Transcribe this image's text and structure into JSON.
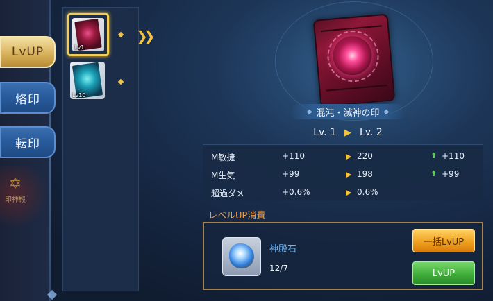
{
  "tabs": [
    {
      "label": "LvUP",
      "active": true
    },
    {
      "label": "烙印",
      "active": false
    },
    {
      "label": "転印",
      "active": false
    }
  ],
  "locked_menu": {
    "icon": "star-emblem-icon",
    "label": "印神殿"
  },
  "card_list": [
    {
      "level_text": "Lv1",
      "selected": true,
      "theme": "red"
    },
    {
      "level_text": "Lv10",
      "selected": false,
      "theme": "cyan"
    }
  ],
  "card": {
    "name": "混沌・滅神の印",
    "level_from": "Lv. 1",
    "level_to": "Lv. 2"
  },
  "stats": [
    {
      "name": "M敏捷",
      "current": "+110",
      "next": "220",
      "diff": "+110"
    },
    {
      "name": "M生気",
      "current": "+99",
      "next": "198",
      "diff": "+99"
    },
    {
      "name": "超過ダメ",
      "current": "+0.6%",
      "next": "0.6%",
      "diff": ""
    }
  ],
  "cost": {
    "title": "レベルUP消費",
    "item_name": "神殿石",
    "item_count": "12/7"
  },
  "buttons": {
    "bulk_lvup": "一括LvUP",
    "lvup": "LvUP"
  },
  "colors": {
    "accent_gold": "#f5c542",
    "increase_green": "#57d04a",
    "cost_title": "#ef9b4a",
    "item_name": "#6fb3f2"
  }
}
